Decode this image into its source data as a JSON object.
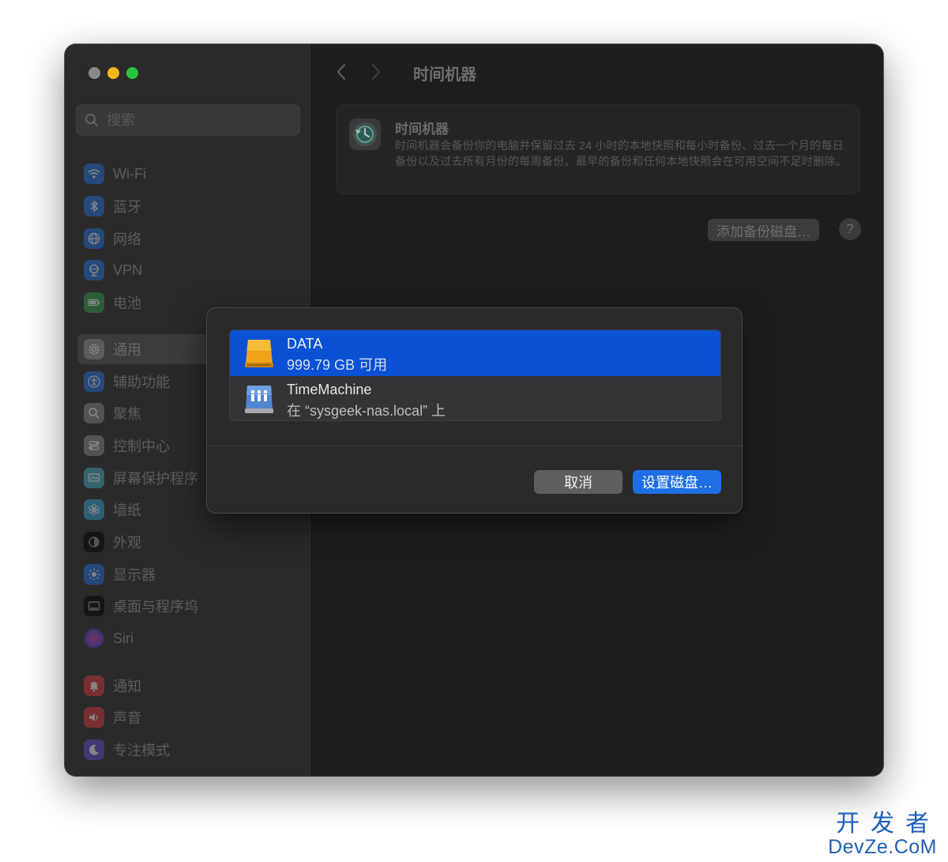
{
  "window": {
    "title": "时间机器",
    "traffic_lights": [
      "close",
      "minimize",
      "zoom"
    ]
  },
  "search": {
    "placeholder": "搜索",
    "icon": "search-icon"
  },
  "sidebar": {
    "items": [
      {
        "label": "Wi-Fi",
        "icon": "wifi-icon",
        "color": "#1c74e8"
      },
      {
        "label": "蓝牙",
        "icon": "bluetooth-icon",
        "color": "#1c74e8"
      },
      {
        "label": "网络",
        "icon": "globe-icon",
        "color": "#1c74e8"
      },
      {
        "label": "VPN",
        "icon": "vpn-globe-icon",
        "color": "#1c74e8"
      },
      {
        "label": "电池",
        "icon": "battery-icon",
        "color": "#2da74a"
      },
      {
        "label": "通用",
        "icon": "gear-icon",
        "color": "#8a8a8e",
        "selected": true
      },
      {
        "label": "辅助功能",
        "icon": "accessibility-icon",
        "color": "#1c74e8"
      },
      {
        "label": "聚焦",
        "icon": "spotlight-icon",
        "color": "#8a8a8e"
      },
      {
        "label": "控制中心",
        "icon": "control-center-icon",
        "color": "#8a8a8e"
      },
      {
        "label": "屏幕保护程序",
        "icon": "screensaver-icon",
        "color": "#3fb5c9"
      },
      {
        "label": "墙纸",
        "icon": "wallpaper-icon",
        "color": "#34a6de"
      },
      {
        "label": "外观",
        "icon": "appearance-icon",
        "color": "#1d1d1f"
      },
      {
        "label": "显示器",
        "icon": "display-icon",
        "color": "#1c74e8"
      },
      {
        "label": "桌面与程序坞",
        "icon": "dock-icon",
        "color": "#1d1d1f"
      },
      {
        "label": "Siri",
        "icon": "siri-icon",
        "color": "#a34fd6"
      },
      {
        "label": "通知",
        "icon": "bell-icon",
        "color": "#e5383b"
      },
      {
        "label": "声音",
        "icon": "speaker-icon",
        "color": "#e5383b"
      },
      {
        "label": "专注模式",
        "icon": "moon-icon",
        "color": "#5a4fd8"
      }
    ]
  },
  "main": {
    "title": "时间机器",
    "card": {
      "title": "时间机器",
      "description": "时间机器会备份你的电脑并保留过去 24 小时的本地快照和每小时备份、过去一个月的每日备份以及过去所有月份的每周备份。最早的备份和任何本地快照会在可用空间不足时删除。"
    },
    "add_disk_label": "添加备份磁盘…",
    "help_label": "?"
  },
  "sheet": {
    "disks": [
      {
        "name": "DATA",
        "subtitle": "999.79 GB 可用",
        "icon": "external-drive-icon",
        "selected": true
      },
      {
        "name": "TimeMachine",
        "subtitle": "在 “sysgeek-nas.local” 上",
        "icon": "network-share-icon",
        "selected": false
      }
    ],
    "cancel_label": "取消",
    "confirm_label": "设置磁盘…"
  },
  "watermark": {
    "cn": "开发者",
    "en": "DevZe.CoM"
  },
  "colors": {
    "selection": "#0a51d4",
    "accent": "#1f6fe4",
    "window_bg": "#1e1e1f"
  }
}
